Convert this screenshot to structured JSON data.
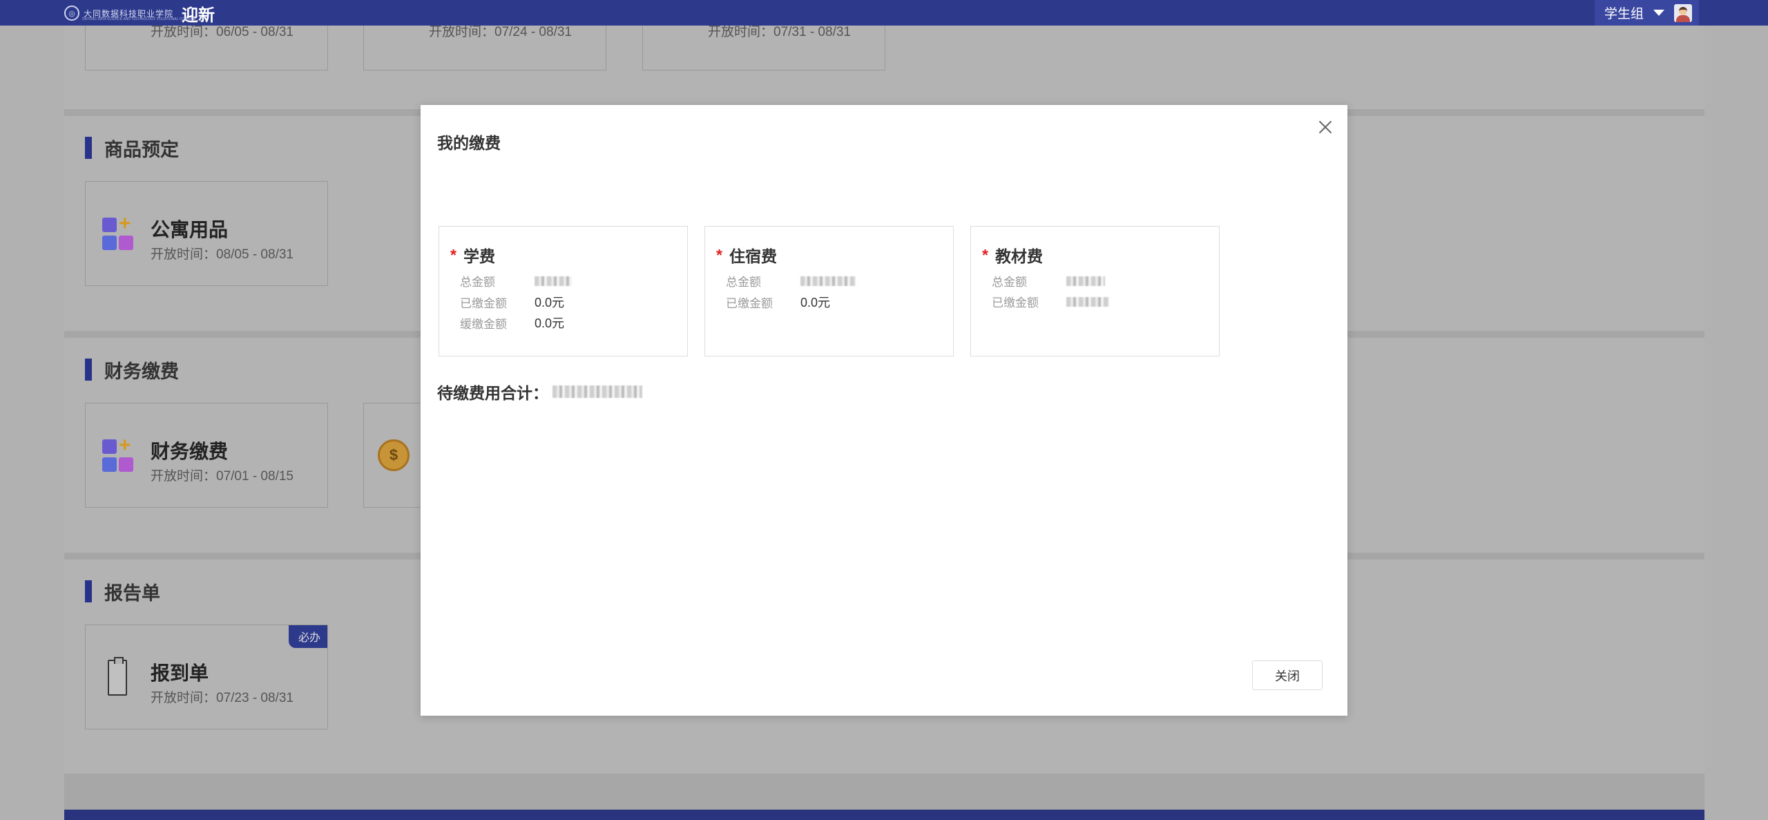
{
  "header": {
    "school_name": "大同数据科技职业学院",
    "school_sub": "DATONG DATA SCIENCE AND TECHNOLOGY VOCATIONAL COLLEGE",
    "app_title": "迎新",
    "user_name": "学生组"
  },
  "sections": [
    {
      "title": "",
      "cards": [
        {
          "title": "",
          "time": "开放时间：06/05 - 08/31"
        },
        {
          "title": "",
          "time": "开放时间：07/24 - 08/31"
        },
        {
          "title": "",
          "time": "开放时间：07/31 - 08/31"
        }
      ]
    },
    {
      "title": "商品预定",
      "cards": [
        {
          "title": "公寓用品",
          "time": "开放时间：08/05 - 08/31"
        }
      ]
    },
    {
      "title": "财务缴费",
      "cards": [
        {
          "title": "财务缴费",
          "time": "开放时间：07/01 - 08/15"
        },
        {
          "title": "",
          "time": ""
        }
      ]
    },
    {
      "title": "报告单",
      "cards": [
        {
          "title": "报到单",
          "time": "开放时间：07/23 - 08/31",
          "badge": "必办"
        }
      ]
    }
  ],
  "modal": {
    "title": "我的缴费",
    "fees": [
      {
        "name": "学费",
        "rows": [
          {
            "label": "总金额",
            "value": ""
          },
          {
            "label": "已缴金额",
            "value": "0.0元"
          },
          {
            "label": "缓缴金额",
            "value": "0.0元"
          }
        ]
      },
      {
        "name": "住宿费",
        "rows": [
          {
            "label": "总金额",
            "value": ""
          },
          {
            "label": "已缴金额",
            "value": "0.0元"
          }
        ]
      },
      {
        "name": "教材费",
        "rows": [
          {
            "label": "总金额",
            "value": ""
          },
          {
            "label": "已缴金额",
            "value": ""
          }
        ]
      }
    ],
    "total_label": "待缴费用合计：",
    "close_button": "关闭"
  },
  "colors": {
    "topbar": "#2d3a8c",
    "section_accent": "#27328a",
    "required_star": "#e02020",
    "overlay_page": "#b1b1b1"
  }
}
